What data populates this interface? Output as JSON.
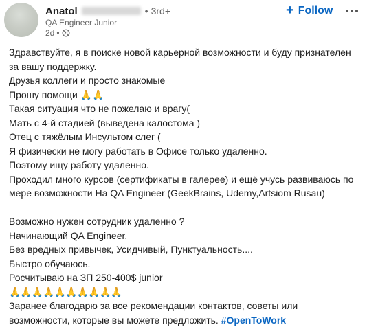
{
  "author": {
    "name": "Anatol",
    "degree": "3rd+",
    "headline": "QA Engineer Junior",
    "time": "2d",
    "time_separator": "•",
    "name_separator": "•",
    "avatar_icon": "avatar-blurred",
    "visibility_icon": "globe-icon"
  },
  "actions": {
    "follow_label": "Follow",
    "follow_icon": "+",
    "more_icon": "ellipsis-icon"
  },
  "post": {
    "lines": [
      "Здравствуйте, я в поиске новой карьерной возможности и буду признателен",
      "за вашу поддержку.",
      "Друзья коллеги и просто знакомые",
      "Прошу помощи 🙏🙏",
      "Такая ситуация что не пожелаю и врагу(",
      "Мать с 4-й стадией (выведена калостома )",
      "Отец с тяжёлым Инсультом слег (",
      "Я физически не могу работать в Офисе только удаленно.",
      "Поэтому ищу работу удаленно.",
      "Проходил много курсов (сертификаты в галерее) и ещё учусь развиваюсь по",
      "мере возможности На QA Engineer (GeekBrains, Udemy,Artsiom Rusau)",
      "",
      "Возможно нужен сотрудник удаленно ?",
      "Начинающий QA Engineer.",
      "Без вредных привычек, Усидчивый, Пунктуальность....",
      "Быстро обучаюсь.",
      "Росчитываю на ЗП 250-400$ junior",
      "🙏🙏🙏🙏🙏🙏🙏🙏🙏🙏",
      "Заранее благодарю за все рекомендации контактов, советы или"
    ],
    "last_line_text": "возможности, которые вы можете предложить. ",
    "hashtag": "#OpenToWork"
  },
  "colors": {
    "accent": "#0a66c2",
    "text": "#1f1f1f",
    "muted": "#666666"
  }
}
